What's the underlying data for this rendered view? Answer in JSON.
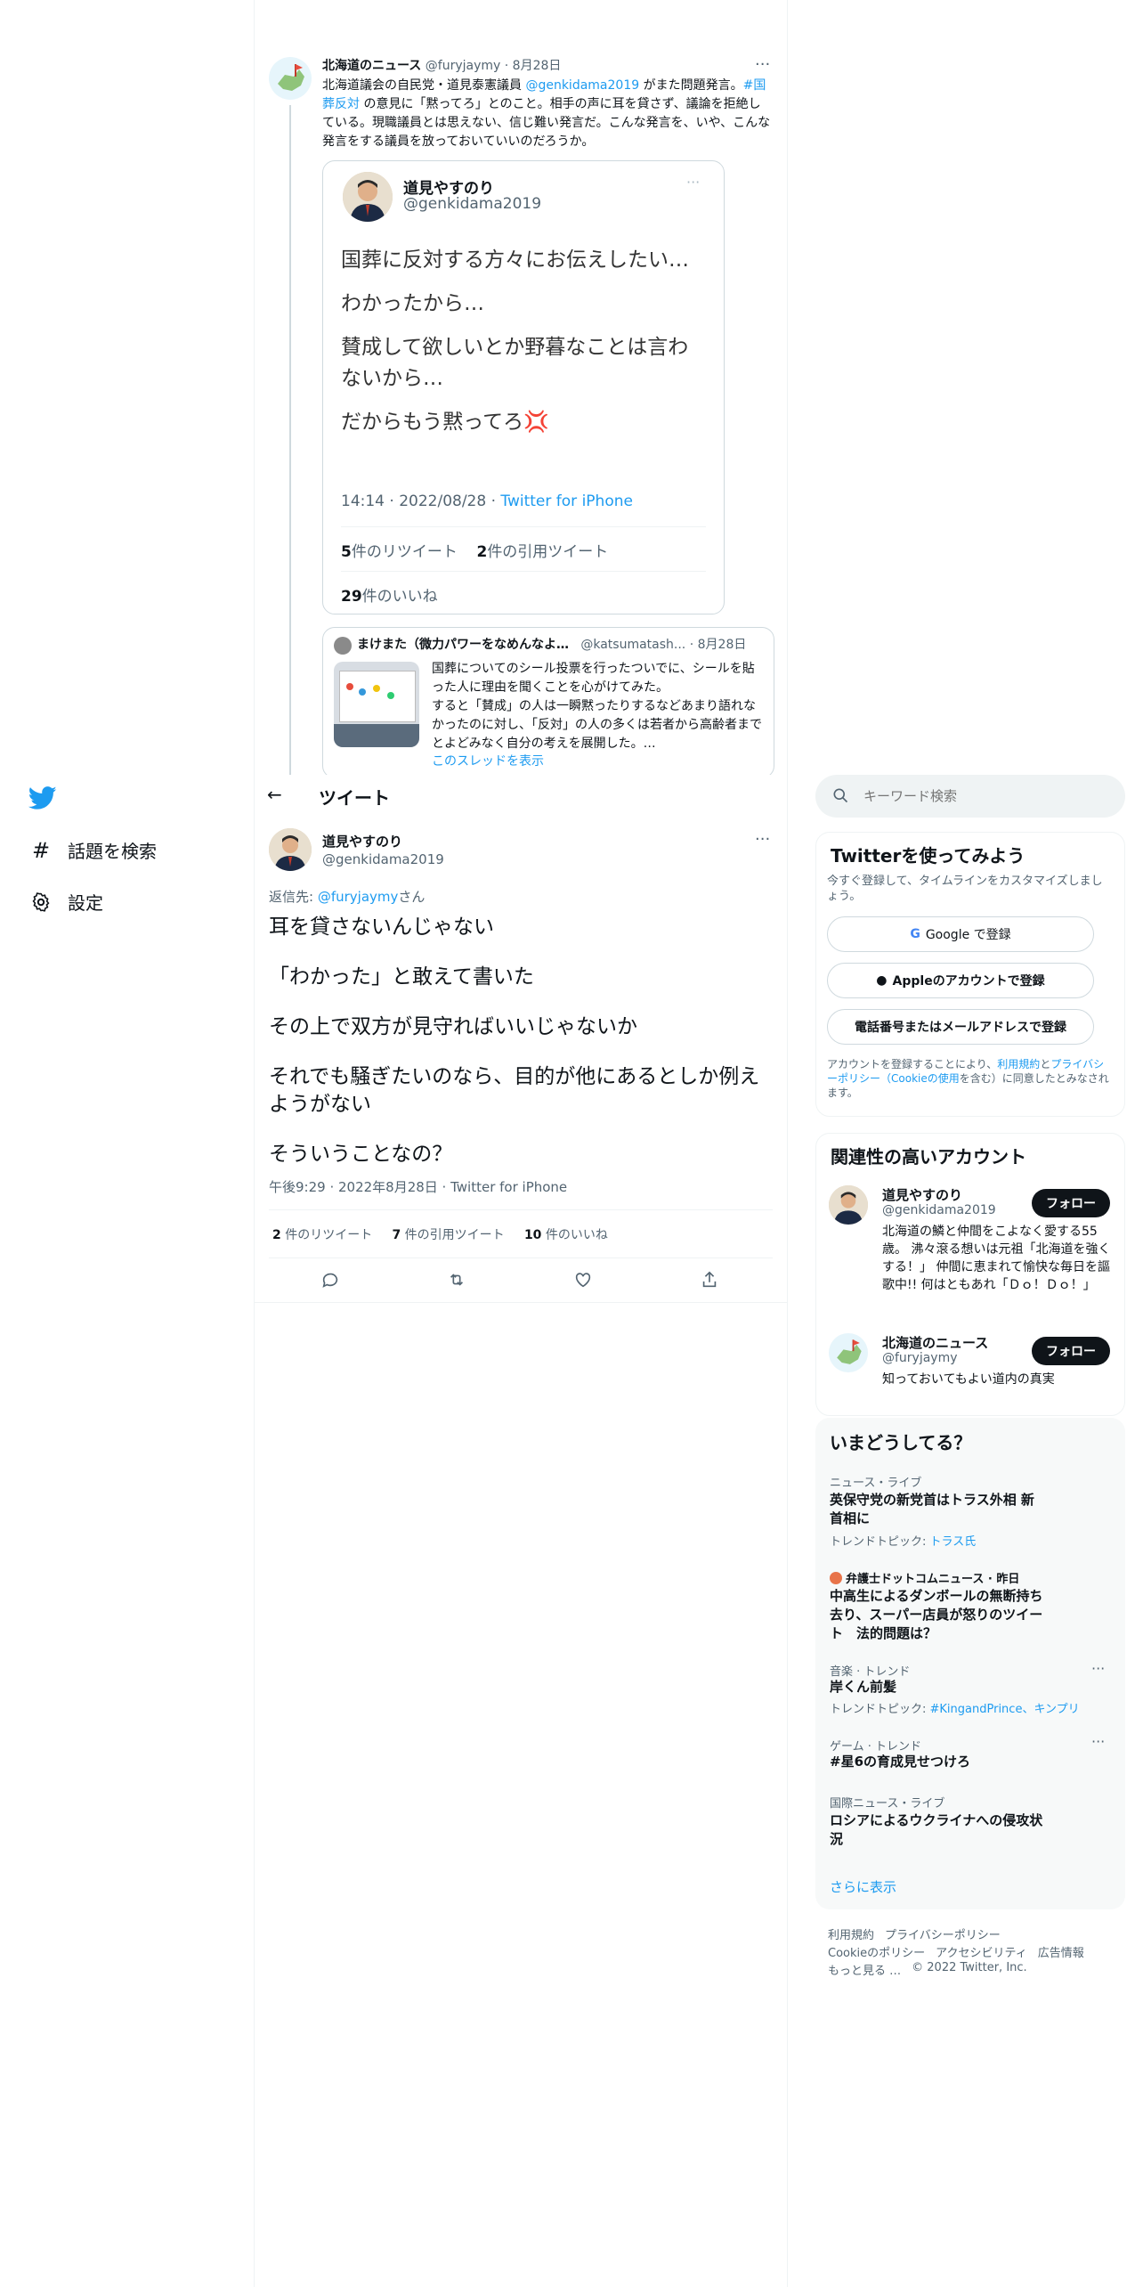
{
  "nav": {
    "explore": "話題を検索",
    "settings": "設定"
  },
  "quoted_tweet": {
    "author_name": "北海道のニュース",
    "author_handle": "@furyjaymy",
    "date": "8月28日",
    "text_1": "北海道議会の自民党・道見泰憲議員 ",
    "mention": "@genkidama2019",
    "text_2": " がまた問題発言。",
    "hashtag": "#国葬反対",
    "text_3": " の意見に「黙ってろ」とのこと。相手の声に耳を貸さず、議論を拒絶している。現職議員とは思えない、信じ難い発言だ。こんな発言を、いや、こんな発言をする議員を放っておいていいのだろうか。"
  },
  "embedded": {
    "author_name": "道見やすのり",
    "author_handle": "@genkidama2019",
    "lines": [
      "国葬に反対する方々にお伝えしたい…",
      "わかったから…",
      "賛成して欲しいとか野暮なことは言わないから…",
      "だからもう黙ってろ💢"
    ],
    "timestamp": "14:14 · 2022/08/28 · ",
    "source": "Twitter for iPhone",
    "retweets_count": "5",
    "retweets_label": "件のリツイート",
    "quotes_count": "2",
    "quotes_label": "件の引用ツイート",
    "likes_count": "29",
    "likes_label": "件のいいね"
  },
  "reply_card": {
    "author_name": "まけまた（微力パワーをなめんなよ…",
    "author_handle": "@katsumatash...",
    "date": "8月28日",
    "text": "国葬についてのシール投票を行ったついでに、シールを貼った人に理由を聞くことを心がけてみた。\nすると「賛成」の人は一瞬黙ったりするなどあまり語れなかったのに対し、「反対」の人の多くは若者から高齢者までとよどみなく自分の考えを展開した。…",
    "show_thread": "このスレッドを表示"
  },
  "header": {
    "title": "ツイート"
  },
  "main_tweet": {
    "author_name": "道見やすのり",
    "author_handle": "@genkidama2019",
    "reply_prefix": "返信先: ",
    "reply_to": "@furyjaymy",
    "reply_suffix": "さん",
    "paragraphs": [
      "耳を貸さないんじゃない",
      "「わかった」と敢えて書いた",
      "その上で双方が見守ればいいじゃないか",
      "それでも騒ぎたいのなら、目的が他にあるとしか例えようがない",
      "そういうことなの？"
    ],
    "timestamp": "午後9:29 · 2022年8月28日 · Twitter for iPhone",
    "retweets_count": "2",
    "retweets_label": "件のリツイート",
    "quotes_count": "7",
    "quotes_label": "件の引用ツイート",
    "likes_count": "10",
    "likes_label": "件のいいね"
  },
  "search": {
    "placeholder": "キーワード検索"
  },
  "signup": {
    "title": "Twitterを使ってみよう",
    "subtitle": "今すぐ登録して、タイムラインをカスタマイズしましょう。",
    "google": "Google で登録",
    "apple": "Appleのアカウントで登録",
    "phone": "電話番号またはメールアドレスで登録",
    "terms_1": "アカウントを登録することにより、",
    "terms_link1": "利用規約",
    "terms_2": "と",
    "terms_link2": "プライバシーポリシー（Cookieの使用",
    "terms_3": "を含む）に同意したとみなされます。"
  },
  "related": {
    "title": "関連性の高いアカウント",
    "accounts": [
      {
        "name": "道見やすのり",
        "handle": "@genkidama2019",
        "bio": "北海道の鱗と仲間をこよなく愛する55歳。 沸々滾る想いは元祖「北海道を強くする！」 仲間に恵まれて愉快な毎日を謳歌中!! 何はともあれ「Ｄｏ！Ｄｏ！」",
        "follow": "フォロー"
      },
      {
        "name": "北海道のニュース",
        "handle": "@furyjaymy",
        "bio": "知っておいてもよい道内の真実",
        "follow": "フォロー"
      }
    ]
  },
  "trends": {
    "title": "いまどうしてる？",
    "items": [
      {
        "category": "ニュース・ライブ",
        "title": "英保守党の新党首はトラス外相 新首相に",
        "sub_label": "トレンドトピック: ",
        "sub_link": "トラス氏"
      },
      {
        "category": "弁護士ドットコムニュース · 昨日",
        "title": "中高生によるダンボールの無断持ち去り、スーパー店員が怒りのツイート　法的問題は？",
        "sub_label": "",
        "sub_link": ""
      },
      {
        "category": "音楽 · トレンド",
        "title": "岸くん前髪",
        "sub_label": "トレンドトピック: ",
        "sub_link": "#KingandPrince、キンプリ"
      },
      {
        "category": "ゲーム · トレンド",
        "title": "#星6の育成見せつけろ",
        "sub_label": "",
        "sub_link": ""
      },
      {
        "category": "国際ニュース・ライブ",
        "title": "ロシアによるウクライナへの侵攻状況",
        "sub_label": "",
        "sub_link": ""
      }
    ],
    "show_more": "さらに表示"
  },
  "footer": {
    "terms": "利用規約",
    "privacy": "プライバシーポリシー",
    "cookies": "Cookieのポリシー",
    "accessibility": "アクセシビリティ",
    "ads": "広告情報",
    "more": "もっと見る …",
    "copyright": "© 2022 Twitter, Inc."
  }
}
